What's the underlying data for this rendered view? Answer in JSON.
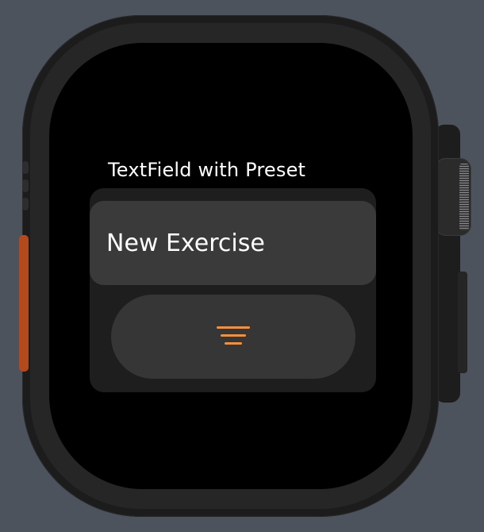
{
  "screen": {
    "title": "TextField with Preset",
    "text_field": {
      "value": "New Exercise"
    },
    "preset_button": {
      "icon": "line-decrease-icon",
      "icon_color": "#f6913b"
    }
  },
  "colors": {
    "background": "#4d535c",
    "screen": "#000000",
    "panel": "#1e1e1f",
    "field": "#3a3a3b",
    "button": "#363637",
    "accent": "#f6913b",
    "action_button": "#b24a1d"
  }
}
